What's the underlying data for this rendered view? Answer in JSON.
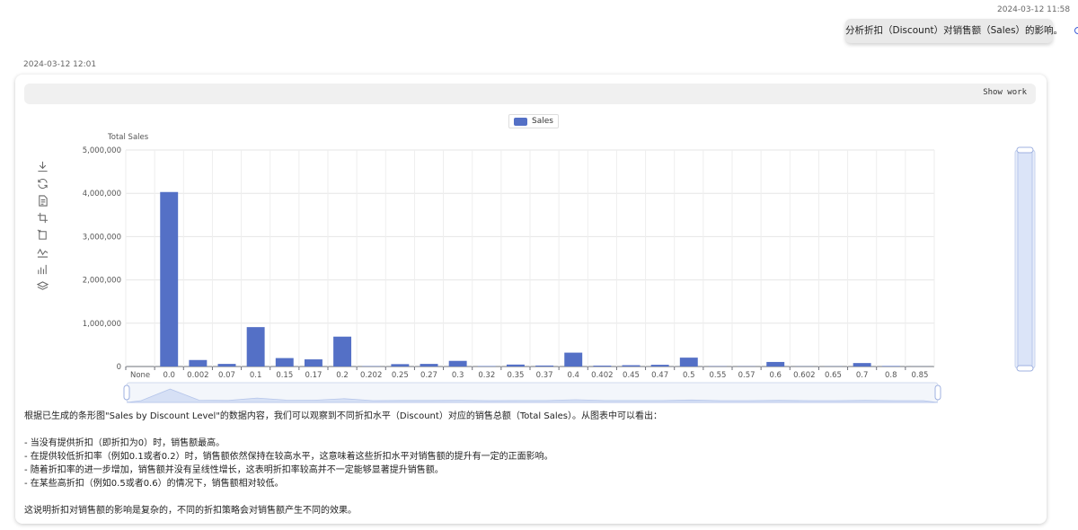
{
  "conversation": {
    "user_timestamp": "2024-03-12 11:58",
    "user_message": "分析折扣（Discount）对销售额（Sales）的影响。",
    "bot_timestamp": "2024-03-12 12:01",
    "show_work_label": "Show work"
  },
  "toolbox": {
    "icons": [
      "download-icon",
      "refresh-icon",
      "data-view-icon",
      "zoom-icon",
      "zoom-reset-icon",
      "line-chart-icon",
      "bar-chart-icon",
      "stack-icon"
    ]
  },
  "chart_data": {
    "type": "bar",
    "ylabel": "Total Sales",
    "xlabel": "",
    "legend_position": "top-center",
    "series": [
      {
        "name": "Sales",
        "color": "#5470c6",
        "values": [
          0,
          4030000,
          150000,
          60000,
          910000,
          195000,
          165000,
          690000,
          8000,
          55000,
          60000,
          130000,
          10000,
          45000,
          22000,
          320000,
          20000,
          30000,
          40000,
          205000,
          6000,
          5000,
          105000,
          4000,
          4000,
          80000,
          12000,
          2000
        ]
      }
    ],
    "categories": [
      "None",
      "0.0",
      "0.002",
      "0.07",
      "0.1",
      "0.15",
      "0.17",
      "0.2",
      "0.202",
      "0.25",
      "0.27",
      "0.3",
      "0.32",
      "0.35",
      "0.37",
      "0.4",
      "0.402",
      "0.45",
      "0.47",
      "0.5",
      "0.55",
      "0.57",
      "0.6",
      "0.602",
      "0.65",
      "0.7",
      "0.8",
      "0.85"
    ],
    "ylim": [
      0,
      5000000
    ],
    "yticks": [
      "0",
      "1,000,000",
      "2,000,000",
      "3,000,000",
      "4,000,000",
      "5,000,000"
    ],
    "grid": true,
    "datazoom_x": [
      0,
      100
    ],
    "datazoom_y": [
      0,
      100
    ]
  },
  "analysis": {
    "intro": "根据已生成的条形图\"Sales by Discount Level\"的数据内容，我们可以观察到不同折扣水平（Discount）对应的销售总额（Total Sales）。从图表中可以看出：",
    "points": [
      "- 当没有提供折扣（即折扣为0）时，销售额最高。",
      "- 在提供较低折扣率（例如0.1或者0.2）时，销售额依然保持在较高水平，这意味着这些折扣水平对销售额的提升有一定的正面影响。",
      "- 随着折扣率的进一步增加，销售额并没有呈线性增长，这表明折扣率较高并不一定能够显著提升销售额。",
      "- 在某些高折扣（例如0.5或者0.6）的情况下，销售额相对较低。"
    ],
    "conclusion": "这说明折扣对销售额的影响是复杂的，不同的折扣策略会对销售额产生不同的效果。"
  }
}
